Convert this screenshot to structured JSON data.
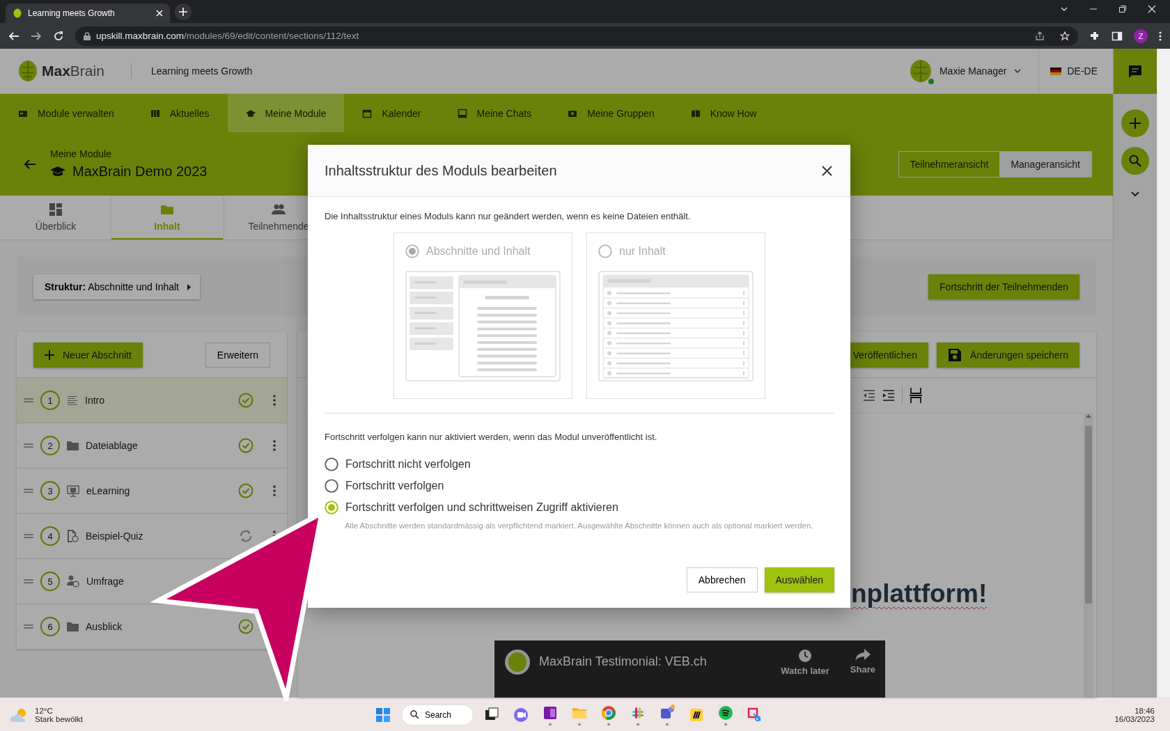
{
  "browser": {
    "tab_title": "Learning meets Growth",
    "url_host": "upskill.maxbrain.com",
    "url_path": "/modules/69/edit/content/sections/112/text",
    "profile": "Z"
  },
  "header": {
    "logo": "**Max**Brain",
    "tagline": "Learning meets Growth",
    "user": "Maxie Manager",
    "user_online": true,
    "language": "DE-DE"
  },
  "nav": [
    {
      "label": "Module verwalten",
      "selected": false
    },
    {
      "label": "Aktuelles",
      "selected": false
    },
    {
      "label": "Meine Module",
      "selected": true
    },
    {
      "label": "Kalender",
      "selected": false
    },
    {
      "label": "Meine Chats",
      "selected": false
    },
    {
      "label": "Meine Gruppen",
      "selected": false
    },
    {
      "label": "Know How",
      "selected": false
    }
  ],
  "module": {
    "breadcrumb": "Meine Module",
    "title": "MaxBrain Demo 2023",
    "views": [
      {
        "label": "Teilnehmeransicht",
        "selected": false
      },
      {
        "label": "Manageransicht",
        "selected": true
      }
    ]
  },
  "tabs": [
    {
      "label": "Überblick",
      "selected": false
    },
    {
      "label": "Inhalt",
      "selected": true
    },
    {
      "label": "Teilnehmende",
      "selected": false
    }
  ],
  "structure_button": "**Struktur:** Abschnitte und Inhalt",
  "progress_button": "Fortschritt der Teilnehmenden",
  "sections_panel": {
    "new_button": "Neuer Abschnitt",
    "expand_button": "Erweitern",
    "sections": [
      {
        "number": "1",
        "title": "Intro",
        "kind": "text",
        "completed": true,
        "syncing": false,
        "selected": true
      },
      {
        "number": "2",
        "title": "Dateiablage",
        "kind": "folder",
        "completed": true,
        "syncing": false,
        "selected": false
      },
      {
        "number": "3",
        "title": "eLearning",
        "kind": "elearning",
        "completed": true,
        "syncing": false,
        "selected": false
      },
      {
        "number": "4",
        "title": "Beispiel-Quiz",
        "kind": "quiz",
        "completed": false,
        "syncing": true,
        "selected": false
      },
      {
        "number": "5",
        "title": "Umfrage",
        "kind": "survey",
        "completed": false,
        "syncing": false,
        "selected": false
      },
      {
        "number": "6",
        "title": "Ausblick",
        "kind": "folder",
        "completed": true,
        "syncing": false,
        "selected": false
      }
    ]
  },
  "editor": {
    "publish_button": "Veröffentlichen",
    "save_button": "Änderungen speichern",
    "heading": "nplattform!",
    "video": {
      "title": "MaxBrain Testimonial: VEB.ch",
      "watch_later": "Watch later",
      "share": "Share"
    }
  },
  "dialog": {
    "title": "Inhaltsstruktur des Moduls bearbeiten",
    "structure_note": "Die Inhaltsstruktur eines Moduls kann nur geändert werden, wenn es keine Dateien enthält.",
    "structure_disabled": true,
    "structure_options": [
      {
        "label": "Abschnitte und Inhalt",
        "kind": "sections",
        "selected": true
      },
      {
        "label": "nur Inhalt",
        "kind": "list",
        "selected": false
      }
    ],
    "progress_note": "Fortschritt verfolgen kann nur aktiviert werden, wenn das Modul unveröffentlicht ist.",
    "progress_options": [
      {
        "label": "Fortschritt nicht verfolgen",
        "selected": false
      },
      {
        "label": "Fortschritt verfolgen",
        "selected": false
      },
      {
        "label": "Fortschritt verfolgen und schrittweisen Zugriff aktivieren",
        "selected": true
      }
    ],
    "hint": "Alle Abschnitte werden standardmässig als verpflichtend markiert. Ausgewählte Abschnitte können auch als optional markiert werden.",
    "cancel": "Abbrechen",
    "confirm": "Auswählen"
  },
  "taskbar": {
    "temperature": "12°C",
    "weather": "Stark bewölkt",
    "search": "Search",
    "time": "18:46",
    "date": "16/03/2023"
  }
}
